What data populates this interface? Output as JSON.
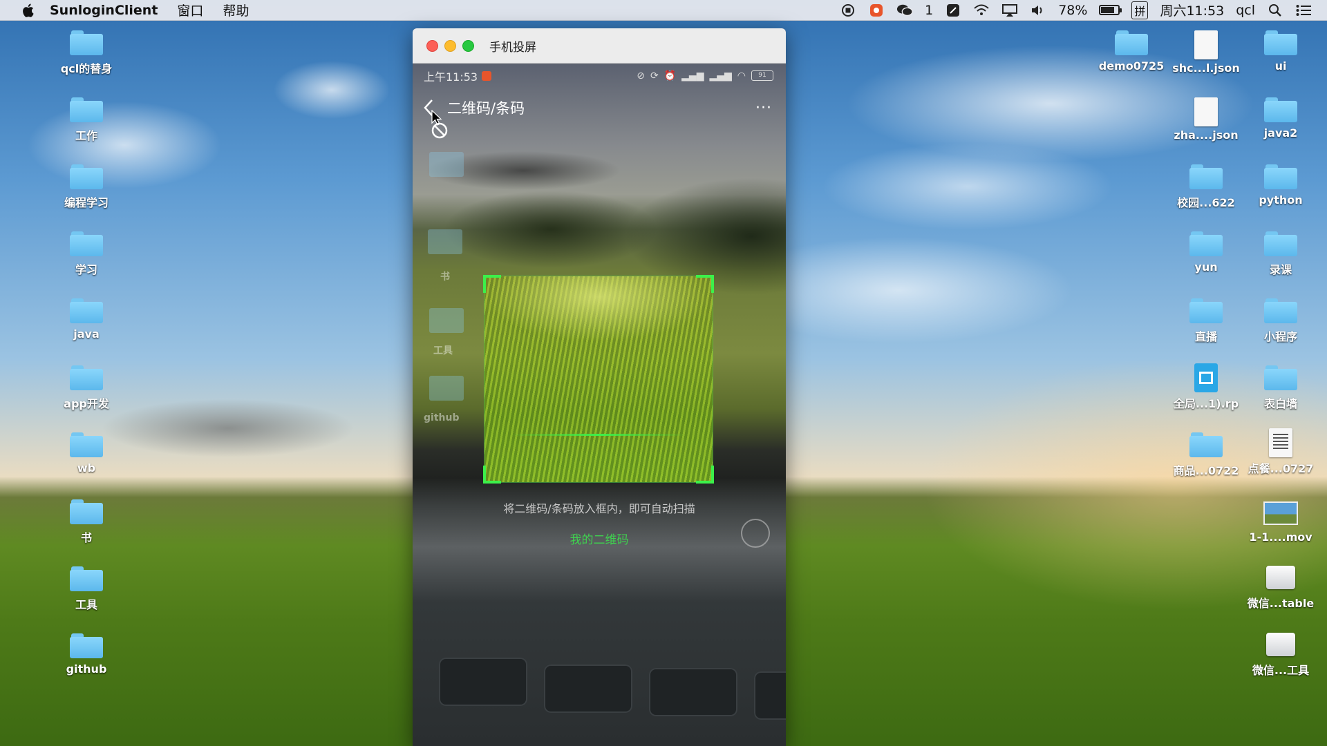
{
  "menubar": {
    "app_name": "SunloginClient",
    "menus": [
      "窗口",
      "帮助"
    ],
    "wechat_count": "1",
    "battery_percent": "78%",
    "battery_level": 0.78,
    "input_method": "拼",
    "clock": "周六11:53",
    "user": "qcl"
  },
  "desktop_left": [
    {
      "label": "qcl的替身",
      "icon": "folder-alias"
    },
    {
      "label": "工作",
      "icon": "folder"
    },
    {
      "label": "编程学习",
      "icon": "folder"
    },
    {
      "label": "学习",
      "icon": "folder"
    },
    {
      "label": "java",
      "icon": "folder"
    },
    {
      "label": "app开发",
      "icon": "folder"
    },
    {
      "label": "wb",
      "icon": "folder"
    },
    {
      "label": "书",
      "icon": "folder"
    },
    {
      "label": "工具",
      "icon": "folder"
    },
    {
      "label": "github",
      "icon": "folder"
    }
  ],
  "desktop_right": [
    {
      "label": "demo0725",
      "icon": "folder"
    },
    {
      "label": "shc...l.json",
      "icon": "document"
    },
    {
      "label": "ui",
      "icon": "folder"
    },
    {
      "label": "zha....json",
      "icon": "document"
    },
    {
      "label": "java2",
      "icon": "folder"
    },
    {
      "label": "校园...622",
      "icon": "folder"
    },
    {
      "label": "python",
      "icon": "folder"
    },
    {
      "label": "yun",
      "icon": "folder"
    },
    {
      "label": "录课",
      "icon": "folder"
    },
    {
      "label": "直播",
      "icon": "folder"
    },
    {
      "label": "小程序",
      "icon": "folder"
    },
    {
      "label": "全局...1).rp",
      "icon": "axure-file"
    },
    {
      "label": "表白墙",
      "icon": "folder"
    },
    {
      "label": "商品...0722",
      "icon": "folder"
    },
    {
      "label": "点餐...0727",
      "icon": "text-document"
    },
    {
      "label": "1-1....mov",
      "icon": "movie-file"
    },
    {
      "label": "微信...table",
      "icon": "drive"
    },
    {
      "label": "微信...工具",
      "icon": "drive"
    }
  ],
  "window": {
    "title": "手机投屏",
    "phone": {
      "time": "上午11:53",
      "battery": "91",
      "nav_title": "二维码/条码",
      "more": "···",
      "hint": "将二维码/条码放入框内，即可自动扫描",
      "my_qr": "我的二维码",
      "ghost_labels": [
        "书",
        "工具",
        "github"
      ]
    }
  },
  "colors": {
    "scan_corner": "#3cf04a",
    "my_qr_link": "#3fd24f",
    "close": "#fc5f57",
    "minimize": "#fdbc2e",
    "zoom": "#28c840"
  }
}
